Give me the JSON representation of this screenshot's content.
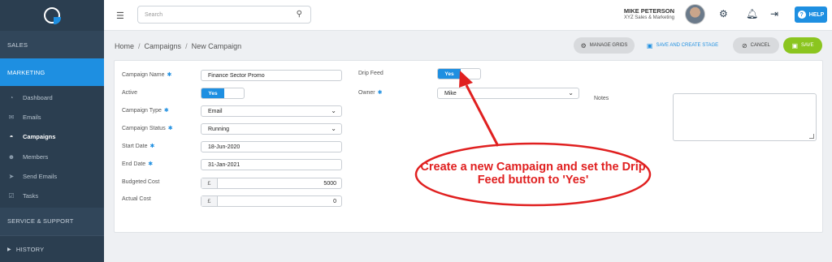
{
  "sidebar": {
    "sections": {
      "sales": "SALES",
      "marketing": "MARKETING",
      "support": "SERVICE & SUPPORT",
      "history": "HISTORY"
    },
    "items": [
      {
        "label": "Dashboard",
        "icon": "dashboard-icon"
      },
      {
        "label": "Emails",
        "icon": "envelope-icon"
      },
      {
        "label": "Campaigns",
        "icon": "campaign-icon"
      },
      {
        "label": "Members",
        "icon": "members-icon"
      },
      {
        "label": "Send Emails",
        "icon": "send-icon"
      },
      {
        "label": "Tasks",
        "icon": "tasks-icon"
      }
    ],
    "active_item": "Campaigns"
  },
  "topbar": {
    "search_placeholder": "Search",
    "user_name": "MIKE PETERSON",
    "user_company": "XYZ Sales & Marketing",
    "help_label": "HELP"
  },
  "breadcrumb": {
    "home": "Home",
    "campaigns": "Campaigns",
    "current": "New Campaign"
  },
  "actions": {
    "manage_grids": "MANAGE GRIDS",
    "save_create_stage": "SAVE AND CREATE STAGE",
    "cancel": "CANCEL",
    "save": "SAVE"
  },
  "form": {
    "campaign_name_label": "Campaign Name",
    "campaign_name_value": "Finance Sector Promo",
    "active_label": "Active",
    "active_value": "Yes",
    "campaign_type_label": "Campaign Type",
    "campaign_type_value": "Email",
    "campaign_status_label": "Campaign Status",
    "campaign_status_value": "Running",
    "start_date_label": "Start Date",
    "start_date_value": "18-Jun-2020",
    "end_date_label": "End Date",
    "end_date_value": "31-Jan-2021",
    "budgeted_cost_label": "Budgeted Cost",
    "budgeted_cost_value": "5000",
    "actual_cost_label": "Actual Cost",
    "actual_cost_value": "0",
    "currency_symbol": "£",
    "drip_feed_label": "Drip Feed",
    "drip_feed_value": "Yes",
    "owner_label": "Owner",
    "owner_value": "Mike",
    "notes_label": "Notes",
    "required_marker": "✱"
  },
  "annotation": {
    "text": "Create a new Campaign and set the Drip Feed button to 'Yes'",
    "color": "#e02020"
  },
  "colors": {
    "accent": "#1e8fe1",
    "sidebar_bg": "#2b3e50",
    "save_green": "#8bc51f"
  }
}
